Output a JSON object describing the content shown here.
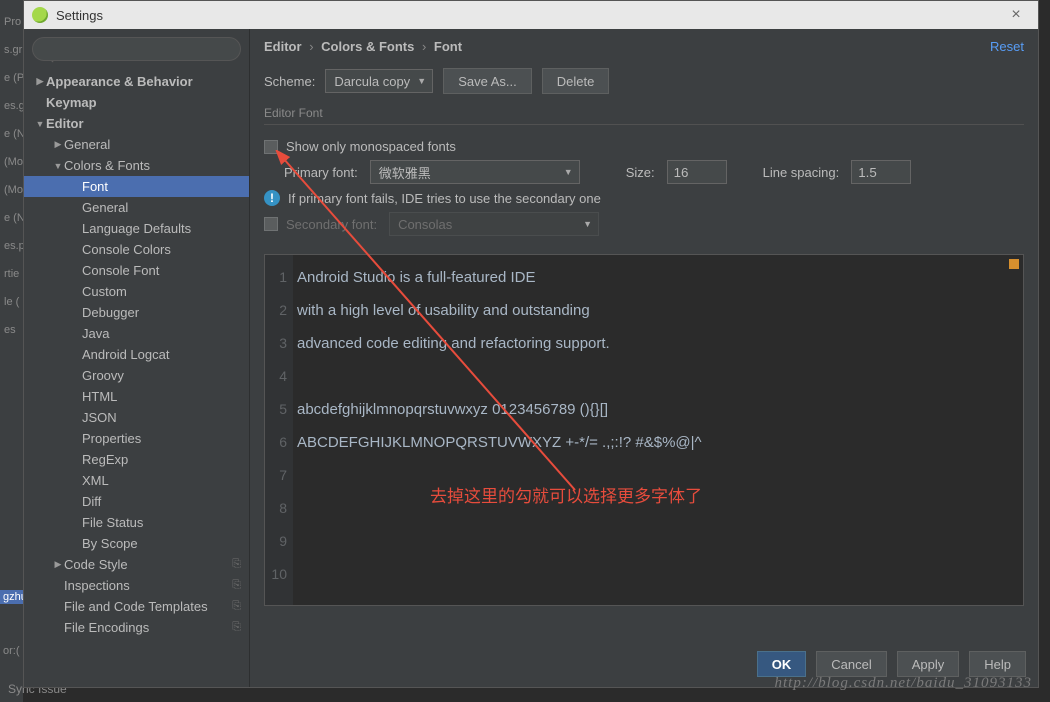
{
  "window": {
    "title": "Settings",
    "close": "×"
  },
  "search": {
    "placeholder": ""
  },
  "tree": [
    {
      "label": "Appearance & Behavior",
      "level": 0,
      "arrow": "closed",
      "bold": true
    },
    {
      "label": "Keymap",
      "level": 0,
      "bold": true
    },
    {
      "label": "Editor",
      "level": 0,
      "arrow": "open",
      "bold": true
    },
    {
      "label": "General",
      "level": 1,
      "arrow": "closed"
    },
    {
      "label": "Colors & Fonts",
      "level": 1,
      "arrow": "open"
    },
    {
      "label": "Font",
      "level": 2,
      "sel": true
    },
    {
      "label": "General",
      "level": 2
    },
    {
      "label": "Language Defaults",
      "level": 2
    },
    {
      "label": "Console Colors",
      "level": 2
    },
    {
      "label": "Console Font",
      "level": 2
    },
    {
      "label": "Custom",
      "level": 2
    },
    {
      "label": "Debugger",
      "level": 2
    },
    {
      "label": "Java",
      "level": 2
    },
    {
      "label": "Android Logcat",
      "level": 2
    },
    {
      "label": "Groovy",
      "level": 2
    },
    {
      "label": "HTML",
      "level": 2
    },
    {
      "label": "JSON",
      "level": 2
    },
    {
      "label": "Properties",
      "level": 2
    },
    {
      "label": "RegExp",
      "level": 2
    },
    {
      "label": "XML",
      "level": 2
    },
    {
      "label": "Diff",
      "level": 2
    },
    {
      "label": "File Status",
      "level": 2
    },
    {
      "label": "By Scope",
      "level": 2
    },
    {
      "label": "Code Style",
      "level": 1,
      "arrow": "closed",
      "cfg": true
    },
    {
      "label": "Inspections",
      "level": 1,
      "cfg": true
    },
    {
      "label": "File and Code Templates",
      "level": 1,
      "cfg": true
    },
    {
      "label": "File Encodings",
      "level": 1,
      "cfg": true
    }
  ],
  "breadcrumbs": {
    "p1": "Editor",
    "p2": "Colors & Fonts",
    "p3": "Font",
    "sep": "›"
  },
  "reset": "Reset",
  "scheme": {
    "label": "Scheme:",
    "value": "Darcula copy",
    "saveAs": "Save As...",
    "delete": "Delete"
  },
  "section": "Editor Font",
  "monospaced": "Show only monospaced fonts",
  "primary": {
    "label": "Primary font:",
    "value": "微软雅黑"
  },
  "size": {
    "label": "Size:",
    "value": "16"
  },
  "spacing": {
    "label": "Line spacing:",
    "value": "1.5"
  },
  "info": "If primary font fails, IDE tries to use the secondary one",
  "secondary": {
    "label": "Secondary font:",
    "value": "Consolas"
  },
  "preview": {
    "l1": "Android Studio is a full-featured IDE",
    "l2": "with a high level of usability and outstanding",
    "l3": "advanced code editing and refactoring support.",
    "l4": "",
    "l5": "abcdefghijklmnopqrstuvwxyz 0123456789 (){}[]",
    "l6": "ABCDEFGHIJKLMNOPQRSTUVWXYZ +-*/= .,;:!? #&$%@|^",
    "lines": [
      "1",
      "2",
      "3",
      "4",
      "5",
      "6",
      "7",
      "8",
      "9",
      "10"
    ]
  },
  "annotation": "去掉这里的勾就可以选择更多字体了",
  "buttons": {
    "ok": "OK",
    "cancel": "Cancel",
    "apply": "Apply",
    "help": "Help"
  },
  "bgItems": [
    "Pro",
    "s.gr",
    "e (P",
    "es.g",
    "e (N",
    "(Mo",
    "(Mo",
    "e (N",
    "es.p",
    "rtie",
    "le (",
    "es"
  ],
  "bg2": [
    "gzhu",
    "or:("
  ],
  "sync": "Sync Issue",
  "watermark": "http://blog.csdn.net/baidu_31093133"
}
